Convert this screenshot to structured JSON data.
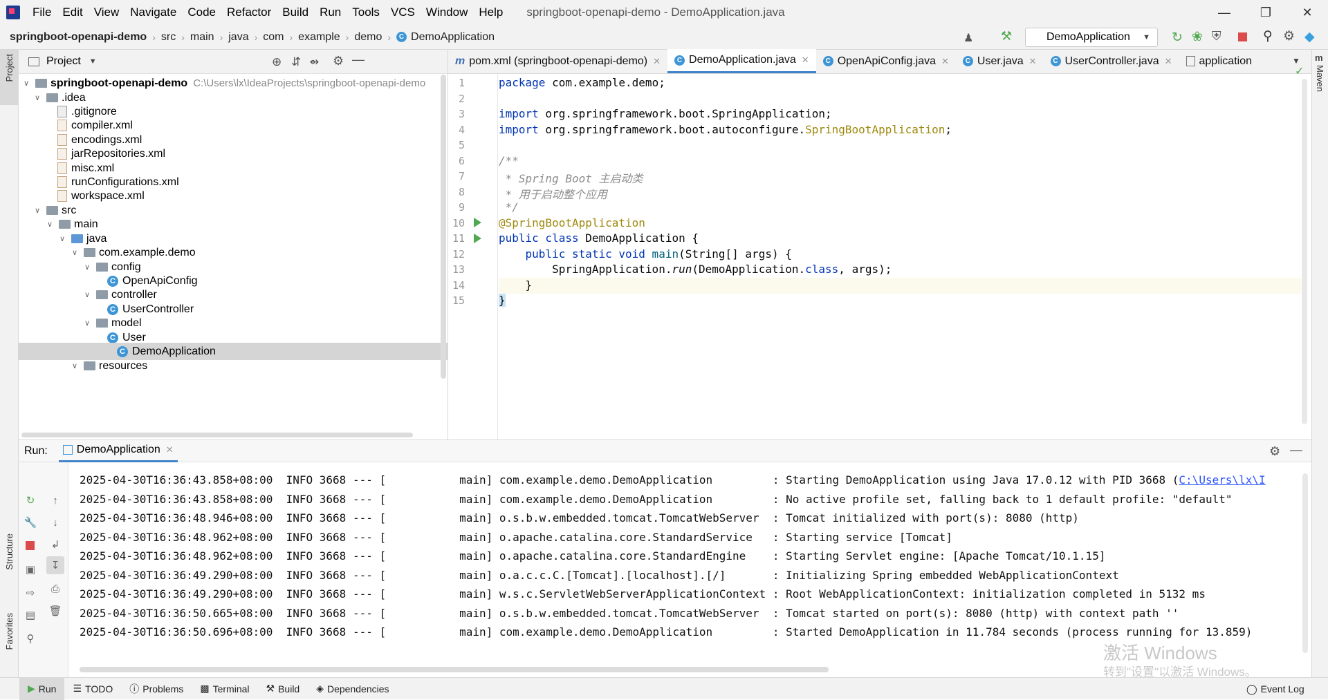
{
  "menubar": {
    "items": [
      "File",
      "Edit",
      "View",
      "Navigate",
      "Code",
      "Refactor",
      "Build",
      "Run",
      "Tools",
      "VCS",
      "Window",
      "Help"
    ],
    "window_title": "springboot-openapi-demo - DemoApplication.java"
  },
  "navbar": {
    "crumbs": [
      "springboot-openapi-demo",
      "src",
      "main",
      "java",
      "com",
      "example",
      "demo",
      "DemoApplication"
    ],
    "run_config": "DemoApplication"
  },
  "side": {
    "project": "Project",
    "structure": "Structure",
    "favorites": "Favorites",
    "maven": "Maven"
  },
  "project_panel": {
    "title": "Project",
    "tree": [
      {
        "label": "springboot-openapi-demo",
        "path": "C:\\Users\\lx\\IdeaProjects\\springboot-openapi-demo"
      },
      {
        "label": ".idea"
      },
      {
        "label": ".gitignore"
      },
      {
        "label": "compiler.xml"
      },
      {
        "label": "encodings.xml"
      },
      {
        "label": "jarRepositories.xml"
      },
      {
        "label": "misc.xml"
      },
      {
        "label": "runConfigurations.xml"
      },
      {
        "label": "workspace.xml"
      },
      {
        "label": "src"
      },
      {
        "label": "main"
      },
      {
        "label": "java"
      },
      {
        "label": "com.example.demo"
      },
      {
        "label": "config"
      },
      {
        "label": "OpenApiConfig"
      },
      {
        "label": "controller"
      },
      {
        "label": "UserController"
      },
      {
        "label": "model"
      },
      {
        "label": "User"
      },
      {
        "label": "DemoApplication"
      },
      {
        "label": "resources"
      }
    ]
  },
  "editor": {
    "tabs": [
      "pom.xml (springboot-openapi-demo)",
      "DemoApplication.java",
      "OpenApiConfig.java",
      "User.java",
      "UserController.java",
      "application"
    ],
    "line_numbers": [
      "1",
      "2",
      "3",
      "4",
      "5",
      "6",
      "7",
      "8",
      "9",
      "10",
      "11",
      "12",
      "13",
      "14",
      "15"
    ],
    "code": {
      "l1_kw": "package",
      "l1_rest": " com.example.demo;",
      "l3_kw": "import",
      "l3_rest": " org.springframework.boot.SpringApplication;",
      "l4_kw": "import",
      "l4_rest": " org.springframework.boot.autoconfigure.",
      "l4_ann": "SpringBootApplication",
      "l4_end": ";",
      "l6": "/**",
      "l7": " * Spring Boot 主启动类",
      "l8": " * 用于启动整个应用",
      "l9": " */",
      "l10": "@SpringBootApplication",
      "l11_kw": "public class",
      "l11_rest": " DemoApplication {",
      "l12_kw": "    public static void",
      "l12_fn": " main",
      "l12_rest": "(String[] args) {",
      "l13_a": "        SpringApplication.",
      "l13_run": "run",
      "l13_b": "(DemoApplication.",
      "l13_cls": "class",
      "l13_c": ", args);",
      "l14": "    }",
      "l15": "}"
    }
  },
  "run_panel": {
    "label": "Run:",
    "tab": "DemoApplication",
    "logs": [
      {
        "ts": "2025-04-30T16:36:43.858+08:00",
        "level": "INFO",
        "pid": "3668",
        "thread": "main",
        "logger": "com.example.demo.DemoApplication",
        "msg": "Starting DemoApplication using Java 17.0.12 with PID 3668 (",
        "link": "C:\\Users\\lx\\I"
      },
      {
        "ts": "2025-04-30T16:36:43.858+08:00",
        "level": "INFO",
        "pid": "3668",
        "thread": "main",
        "logger": "com.example.demo.DemoApplication",
        "msg": "No active profile set, falling back to 1 default profile: \"default\""
      },
      {
        "ts": "2025-04-30T16:36:48.946+08:00",
        "level": "INFO",
        "pid": "3668",
        "thread": "main",
        "logger": "o.s.b.w.embedded.tomcat.TomcatWebServer",
        "msg": "Tomcat initialized with port(s): 8080 (http)"
      },
      {
        "ts": "2025-04-30T16:36:48.962+08:00",
        "level": "INFO",
        "pid": "3668",
        "thread": "main",
        "logger": "o.apache.catalina.core.StandardService",
        "msg": "Starting service [Tomcat]"
      },
      {
        "ts": "2025-04-30T16:36:48.962+08:00",
        "level": "INFO",
        "pid": "3668",
        "thread": "main",
        "logger": "o.apache.catalina.core.StandardEngine",
        "msg": "Starting Servlet engine: [Apache Tomcat/10.1.15]"
      },
      {
        "ts": "2025-04-30T16:36:49.290+08:00",
        "level": "INFO",
        "pid": "3668",
        "thread": "main",
        "logger": "o.a.c.c.C.[Tomcat].[localhost].[/]",
        "msg": "Initializing Spring embedded WebApplicationContext"
      },
      {
        "ts": "2025-04-30T16:36:49.290+08:00",
        "level": "INFO",
        "pid": "3668",
        "thread": "main",
        "logger": "w.s.c.ServletWebServerApplicationContext",
        "msg": "Root WebApplicationContext: initialization completed in 5132 ms"
      },
      {
        "ts": "2025-04-30T16:36:50.665+08:00",
        "level": "INFO",
        "pid": "3668",
        "thread": "main",
        "logger": "o.s.b.w.embedded.tomcat.TomcatWebServer",
        "msg": "Tomcat started on port(s): 8080 (http) with context path ''"
      },
      {
        "ts": "2025-04-30T16:36:50.696+08:00",
        "level": "INFO",
        "pid": "3668",
        "thread": "main",
        "logger": "com.example.demo.DemoApplication",
        "msg": "Started DemoApplication in 11.784 seconds (process running for 13.859)"
      }
    ]
  },
  "bottombar": {
    "items": [
      "Run",
      "TODO",
      "Problems",
      "Terminal",
      "Build",
      "Dependencies"
    ],
    "event_log": "Event Log"
  },
  "watermark": {
    "line1": "激活 Windows",
    "line2": "转到\"设置\"以激活 Windows。"
  }
}
